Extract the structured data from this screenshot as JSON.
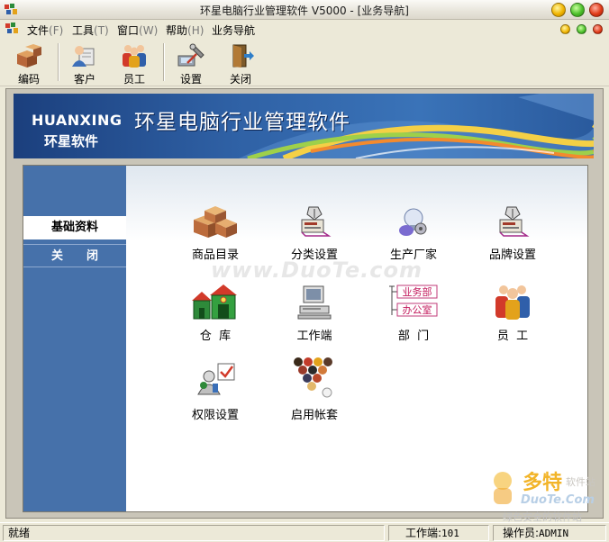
{
  "window": {
    "title": "环星电脑行业管理软件 V5000 - [业务导航]"
  },
  "menu": [
    {
      "label": "文件",
      "key": "(F)"
    },
    {
      "label": "工具",
      "key": "(T)"
    },
    {
      "label": "窗口",
      "key": "(W)"
    },
    {
      "label": "帮助",
      "key": "(H)"
    },
    {
      "label": "业务导航",
      "key": ""
    }
  ],
  "toolbar": [
    {
      "label": "编码",
      "icon": "boxes-icon"
    },
    {
      "label": "客户",
      "icon": "customer-icon"
    },
    {
      "label": "员工",
      "icon": "employees-icon"
    },
    {
      "label": "设置",
      "icon": "settings-icon"
    },
    {
      "label": "关闭",
      "icon": "exit-door-icon"
    }
  ],
  "banner": {
    "brand_en": "HUANXING",
    "brand_cn": "环星软件",
    "title": "环星电脑行业管理软件"
  },
  "sidebar": {
    "items": [
      {
        "label": "基础资料",
        "active": true
      },
      {
        "label": "关闭",
        "active": false
      }
    ]
  },
  "tiles": [
    {
      "label": "商品目录",
      "icon": "boxes-icon"
    },
    {
      "label": "分类设置",
      "icon": "scanner-icon"
    },
    {
      "label": "生产厂家",
      "icon": "factory-bulb-icon"
    },
    {
      "label": "品牌设置",
      "icon": "scanner-icon"
    },
    {
      "label": "仓  库",
      "icon": "warehouse-icon"
    },
    {
      "label": "工作端",
      "icon": "computer-terminal-icon"
    },
    {
      "label": "部  门",
      "icon": "department-tree-icon"
    },
    {
      "label": "员  工",
      "icon": "employees-icon"
    },
    {
      "label": "权限设置",
      "icon": "permission-icon"
    },
    {
      "label": "启用帐套",
      "icon": "billiard-balls-icon"
    }
  ],
  "dept_chart": {
    "top": "业务部",
    "bottom": "办公室"
  },
  "watermark": "www.DuoTe.com",
  "watermark_logo": {
    "big": "多特",
    "small": "软件站",
    "en": "DuoTe.Com",
    "tagline": "绿色安全的软件站"
  },
  "status": {
    "message": "就绪",
    "workstation_label": "工作端:",
    "workstation_value": "101",
    "operator_label": "操作员:",
    "operator_value": "ADMIN"
  },
  "colors": {
    "sidebar_bg": "#4671aa",
    "banner_bg": "#2f61a5",
    "window_chrome": "#ece9d8"
  }
}
